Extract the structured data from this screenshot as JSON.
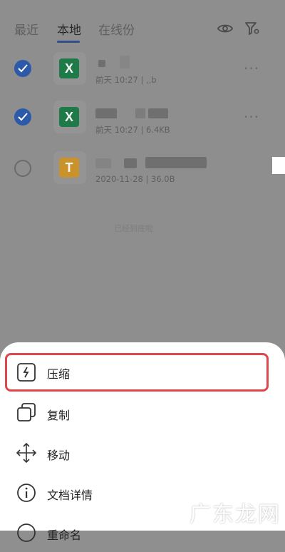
{
  "tabs": [
    {
      "label": "最近",
      "active": false
    },
    {
      "label": "本地",
      "active": true
    },
    {
      "label": "在线份",
      "active": false
    }
  ],
  "header_icons": [
    "eye-icon",
    "filter-settings-icon"
  ],
  "files": [
    {
      "checked": true,
      "type": "X",
      "color": "#1e7a46",
      "meta": "前天 10:27 | ,,b"
    },
    {
      "checked": true,
      "type": "X",
      "color": "#1e7a46",
      "meta": "前天 10:27 | 6.4KB"
    },
    {
      "checked": false,
      "type": "T",
      "color": "#c9922a",
      "meta": "2020-11-28 | 36.0B"
    }
  ],
  "more_label": "···",
  "faint_text": "已经到底啦",
  "sheet": {
    "items": [
      {
        "label": "压缩",
        "icon": "compress-icon"
      },
      {
        "label": "复制",
        "icon": "copy-icon"
      },
      {
        "label": "移动",
        "icon": "move-icon"
      },
      {
        "label": "文档详情",
        "icon": "info-icon"
      },
      {
        "label": "重命名",
        "icon": "rename-icon"
      }
    ]
  },
  "watermark": "广东龙网",
  "colors": {
    "accent": "#2c5aa8",
    "highlight": "#e0474c",
    "overlay": "#8e8e8e"
  }
}
